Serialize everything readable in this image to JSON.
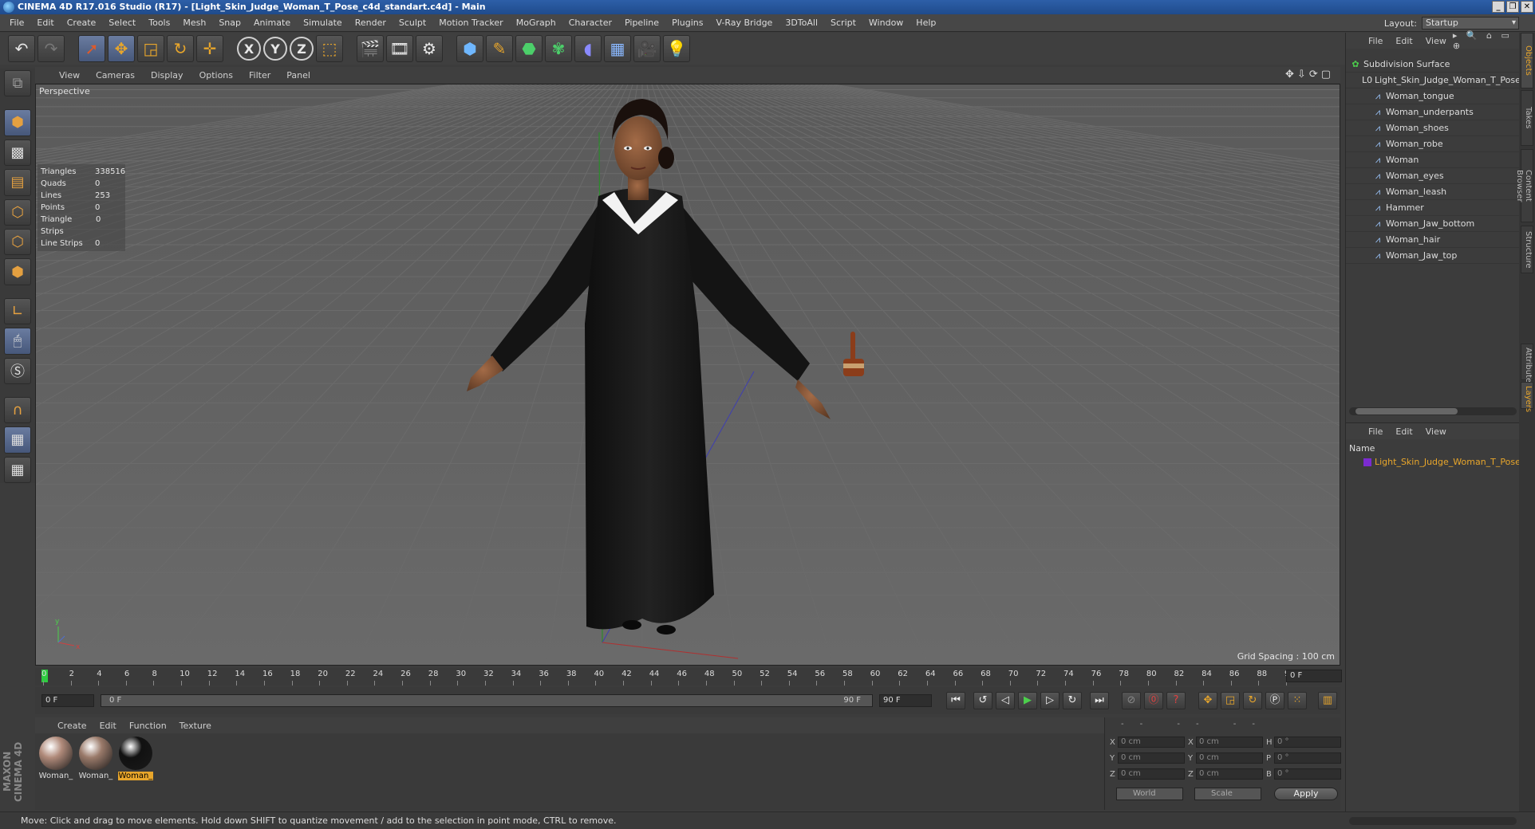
{
  "window": {
    "title": "CINEMA 4D R17.016 Studio (R17) - [Light_Skin_Judge_Woman_T_Pose_c4d_standart.c4d] - Main",
    "controls": [
      "_",
      "❐",
      "✕"
    ]
  },
  "menu": [
    "File",
    "Edit",
    "Create",
    "Select",
    "Tools",
    "Mesh",
    "Snap",
    "Animate",
    "Simulate",
    "Render",
    "Sculpt",
    "Motion Tracker",
    "MoGraph",
    "Character",
    "Pipeline",
    "Plugins",
    "V-Ray Bridge",
    "3DToAll",
    "Script",
    "Window",
    "Help"
  ],
  "layout": {
    "label": "Layout:",
    "value": "Startup"
  },
  "toolbar": {
    "axis_x": "X",
    "axis_y": "Y",
    "axis_z": "Z"
  },
  "viewport": {
    "menu": [
      "View",
      "Cameras",
      "Display",
      "Options",
      "Filter",
      "Panel"
    ],
    "label": "Perspective",
    "stats": [
      {
        "k": "Triangles",
        "v": "338516"
      },
      {
        "k": "Quads",
        "v": "0"
      },
      {
        "k": "Lines",
        "v": "253"
      },
      {
        "k": "Points",
        "v": "0"
      },
      {
        "k": "Triangle Strips",
        "v": "0"
      },
      {
        "k": "Line Strips",
        "v": "0"
      }
    ],
    "grid_spacing": "Grid Spacing : 100 cm",
    "colors": {
      "bg_top": "#5b5b5b",
      "bg_bottom": "#5e5e5e",
      "robe": "#151515",
      "skin": "#8a5a3c",
      "hammer": "#8b3d1a"
    }
  },
  "timeline": {
    "ticks": [
      "0",
      "2",
      "4",
      "6",
      "8",
      "10",
      "12",
      "14",
      "16",
      "18",
      "20",
      "22",
      "24",
      "26",
      "28",
      "30",
      "32",
      "34",
      "36",
      "38",
      "40",
      "42",
      "44",
      "46",
      "48",
      "50",
      "52",
      "54",
      "56",
      "58",
      "60",
      "62",
      "64",
      "66",
      "68",
      "70",
      "72",
      "74",
      "76",
      "78",
      "80",
      "82",
      "84",
      "86",
      "88",
      "90"
    ],
    "current_frame": "0 F",
    "start_field": "0 F",
    "range_start": "0 F",
    "range_end": "90 F",
    "end_field": "90 F"
  },
  "materials": {
    "menu": [
      "Create",
      "Edit",
      "Function",
      "Texture"
    ],
    "items": [
      {
        "name": "Woman_",
        "color": "#b08a7a"
      },
      {
        "name": "Woman_",
        "color": "#9a7a6a"
      },
      {
        "name": "Woman_",
        "color": "#111111"
      }
    ]
  },
  "coordinates": {
    "header": "-- -- --",
    "rows": [
      {
        "a": "X",
        "av": "0 cm",
        "b": "X",
        "bv": "0 cm",
        "c": "H",
        "cv": "0 °"
      },
      {
        "a": "Y",
        "av": "0 cm",
        "b": "Y",
        "bv": "0 cm",
        "c": "P",
        "cv": "0 °"
      },
      {
        "a": "Z",
        "av": "0 cm",
        "b": "Z",
        "bv": "0 cm",
        "c": "B",
        "cv": "0 °"
      }
    ],
    "world": "World",
    "scale": "Scale",
    "apply": "Apply"
  },
  "status": "Move: Click and drag to move elements. Hold down SHIFT to quantize movement / add to the selection in point mode, CTRL to remove.",
  "logo": "MAXON CINEMA 4D",
  "object_manager": {
    "menu": [
      "File",
      "Edit",
      "View"
    ],
    "objects": [
      {
        "name": "Subdivision Surface",
        "indent": 0,
        "icon": "✿"
      },
      {
        "name": "Light_Skin_Judge_Woman_T_Pose",
        "indent": 1,
        "icon": "L0"
      },
      {
        "name": "Woman_tongue",
        "indent": 2,
        "icon": "⩘"
      },
      {
        "name": "Woman_underpants",
        "indent": 2,
        "icon": "⩘"
      },
      {
        "name": "Woman_shoes",
        "indent": 2,
        "icon": "⩘"
      },
      {
        "name": "Woman_robe",
        "indent": 2,
        "icon": "⩘"
      },
      {
        "name": "Woman",
        "indent": 2,
        "icon": "⩘"
      },
      {
        "name": "Woman_eyes",
        "indent": 2,
        "icon": "⩘"
      },
      {
        "name": "Woman_leash",
        "indent": 2,
        "icon": "⩘"
      },
      {
        "name": "Hammer",
        "indent": 2,
        "icon": "⩘"
      },
      {
        "name": "Woman_Jaw_bottom",
        "indent": 2,
        "icon": "⩘"
      },
      {
        "name": "Woman_hair",
        "indent": 2,
        "icon": "⩘"
      },
      {
        "name": "Woman_Jaw_top",
        "indent": 2,
        "icon": "⩘"
      }
    ]
  },
  "layer_manager": {
    "menu": [
      "File",
      "Edit",
      "View"
    ],
    "name_header": "Name",
    "layer": "Light_Skin_Judge_Woman_T_Pose"
  },
  "side_tabs": [
    "Objects",
    "Takes",
    "Content Browser",
    "Structure",
    "Attributes",
    "Layers"
  ]
}
